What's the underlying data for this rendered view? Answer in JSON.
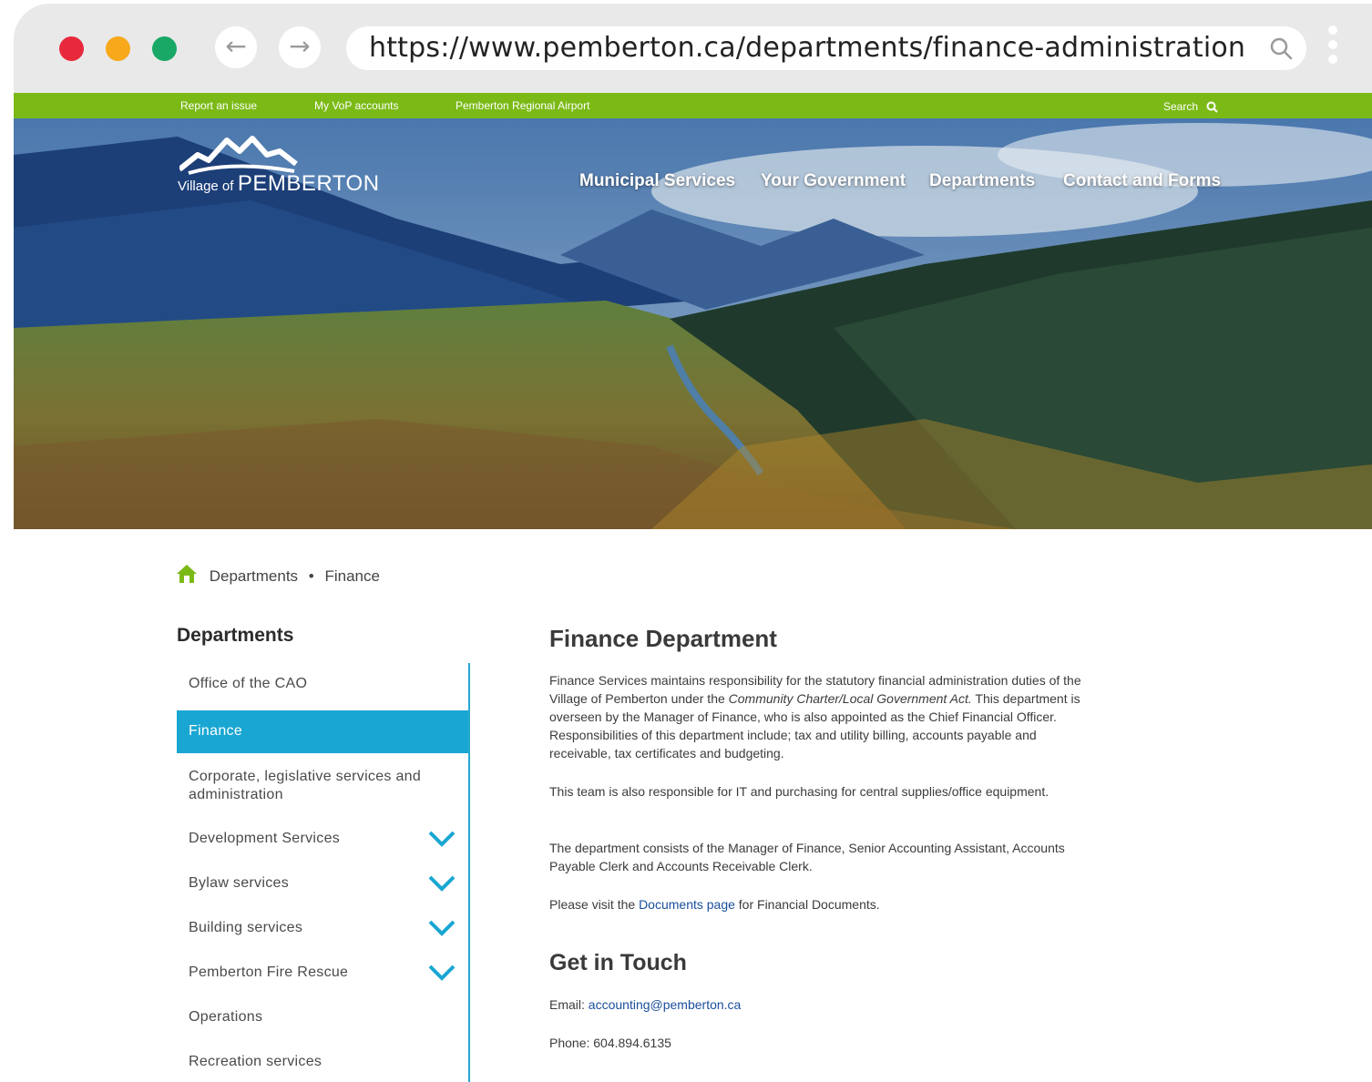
{
  "browser": {
    "url": "https://www.pemberton.ca/departments/finance-administration"
  },
  "utility": {
    "links": [
      "Report an issue",
      "My VoP accounts",
      "Pemberton Regional Airport"
    ],
    "search_label": "Search"
  },
  "logo": {
    "small": "Village of",
    "big": "PEMBERTON"
  },
  "main_nav": [
    "Municipal Services",
    "Your Government",
    "Departments",
    "Contact and Forms"
  ],
  "breadcrumb": {
    "items": [
      "Departments",
      "Finance"
    ],
    "separator": "•"
  },
  "sidebar": {
    "title": "Departments",
    "items": [
      {
        "label": "Office of the CAO"
      },
      {
        "label": "Finance"
      },
      {
        "label": "Corporate, legislative services and administration"
      },
      {
        "label": "Development Services"
      },
      {
        "label": "Bylaw services"
      },
      {
        "label": "Building services"
      },
      {
        "label": "Pemberton Fire Rescue"
      },
      {
        "label": "Operations"
      },
      {
        "label": "Recreation services"
      }
    ]
  },
  "main": {
    "title": "Finance Department",
    "p1_a": "Finance Services maintains responsibility for the statutory financial administration duties of the Village of Pemberton under the ",
    "p1_italic": "Community Charter/Local Government Act.",
    "p1_b": "  This department is overseen by the Manager of Finance, who is also appointed as the Chief Financial Officer.  Responsibilities of this department include; tax and utility billing, accounts payable and receivable, tax certificates and budgeting.",
    "p2": "This team is also responsible for IT and purchasing for central supplies/office equipment.",
    "p3": "The department consists of the Manager of Finance, Senior Accounting Assistant, Accounts Payable Clerk and Accounts Receivable Clerk.",
    "p4_a": "Please visit the ",
    "p4_link": "Documents page",
    "p4_b": " for Financial Documents.",
    "contact_title": "Get in Touch",
    "email_label": "Email: ",
    "email": "accounting@pemberton.ca",
    "phone": "Phone: 604.894.6135"
  },
  "colors": {
    "green_bar": "#7bba16",
    "active_blue": "#19a6d2",
    "link_blue": "#1a4e9c"
  }
}
